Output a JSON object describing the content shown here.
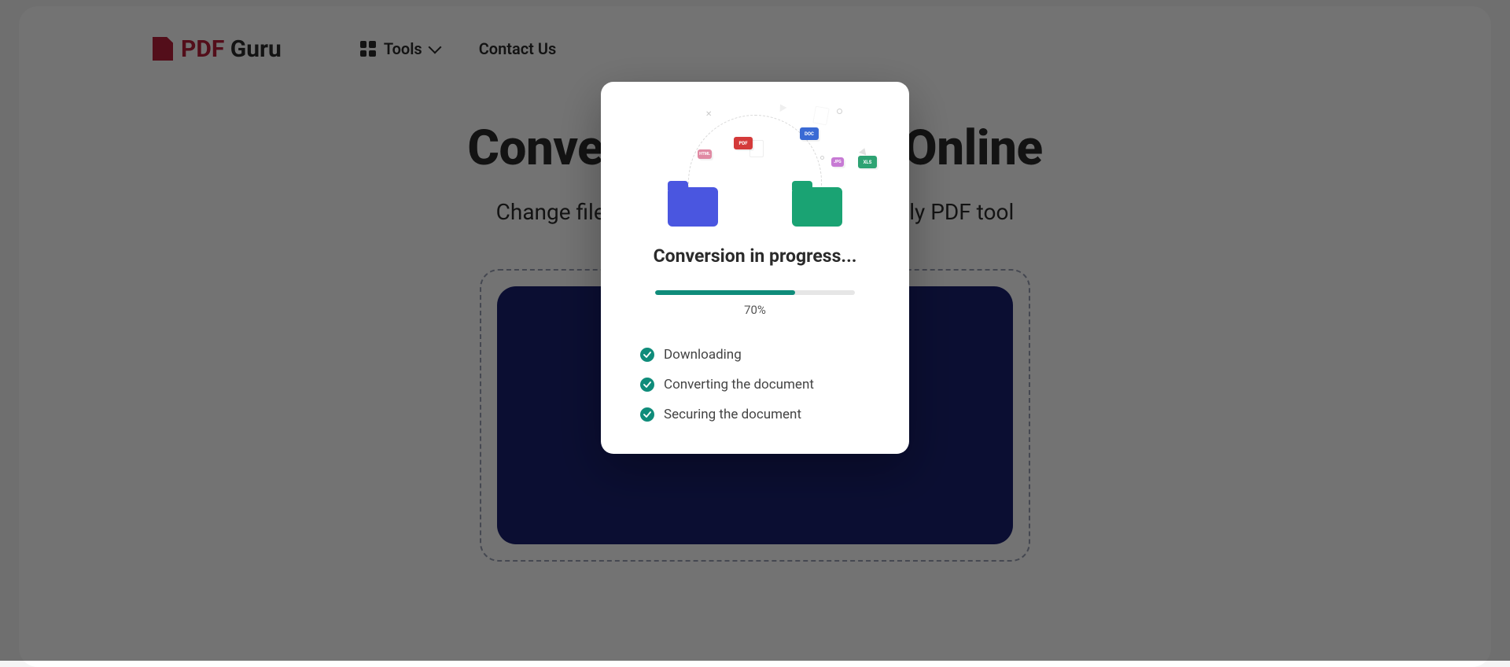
{
  "brand": {
    "prefix": "PDF",
    "suffix": " Guru"
  },
  "nav": {
    "tools": "Tools",
    "contact": "Contact Us"
  },
  "hero": {
    "title": "Convert PDF to XLS Online",
    "subtitle": "Change file format in a flash using a friendly PDF tool"
  },
  "modal": {
    "title": "Conversion in progress...",
    "progress_percent": 70,
    "progress_label": "70%",
    "steps": [
      {
        "label": "Downloading",
        "done": true
      },
      {
        "label": "Converting the document",
        "done": true
      },
      {
        "label": "Securing the document",
        "done": true
      }
    ],
    "minidocs": {
      "pdf": "PDF",
      "doc": "DOC",
      "xls": "XLS",
      "jpg": "JPG",
      "html": "HTML"
    }
  },
  "colors": {
    "brand": "#b81f3a",
    "accent": "#0f8c7a",
    "upload": "#19206f",
    "folder_blue": "#4a56e0",
    "folder_green": "#1aa373"
  }
}
